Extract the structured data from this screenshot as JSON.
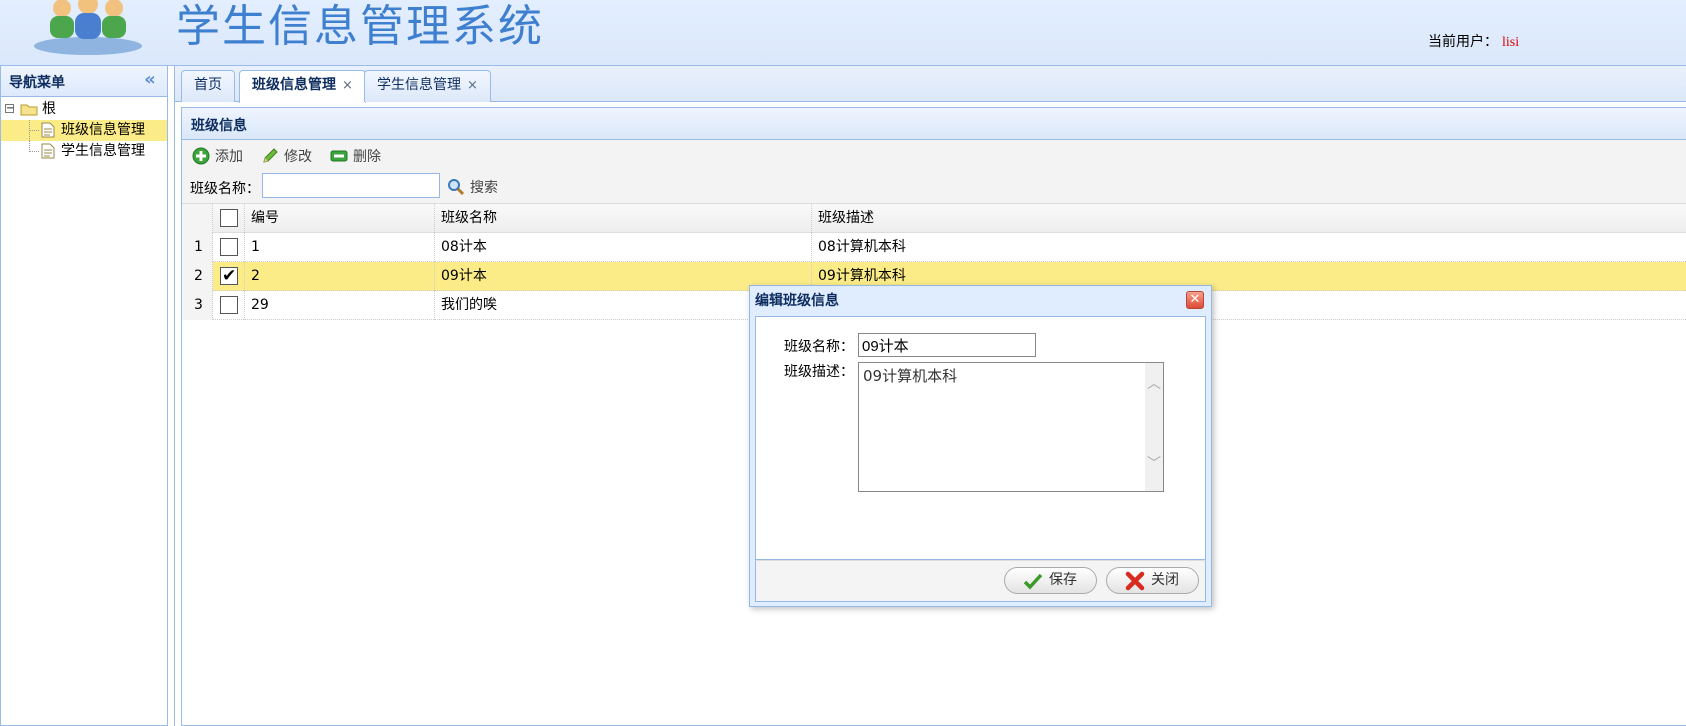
{
  "header": {
    "title": "学生信息管理系统",
    "current_user_label": "当前用户：",
    "current_user": "lisi"
  },
  "nav": {
    "title": "导航菜单",
    "root_label": "根",
    "items": [
      {
        "label": "班级信息管理",
        "selected": true
      },
      {
        "label": "学生信息管理",
        "selected": false
      }
    ]
  },
  "tabs": [
    {
      "label": "首页",
      "closable": false,
      "active": false
    },
    {
      "label": "班级信息管理",
      "closable": true,
      "active": true
    },
    {
      "label": "学生信息管理",
      "closable": true,
      "active": false
    }
  ],
  "panel": {
    "title": "班级信息",
    "toolbar": {
      "add_label": "添加",
      "edit_label": "修改",
      "delete_label": "删除",
      "search_label": "班级名称：",
      "search_value": "",
      "search_button": "搜索"
    }
  },
  "grid": {
    "columns": [
      "编号",
      "班级名称",
      "班级描述"
    ],
    "rows": [
      {
        "num": "1",
        "checked": false,
        "id": "1",
        "name": "08计本",
        "desc": "08计算机本科"
      },
      {
        "num": "2",
        "checked": true,
        "id": "2",
        "name": "09计本",
        "desc": "09计算机本科"
      },
      {
        "num": "3",
        "checked": false,
        "id": "29",
        "name": "我们的唉",
        "desc": ""
      }
    ]
  },
  "dialog": {
    "title": "编辑班级信息",
    "name_label": "班级名称：",
    "name_value": "09计本",
    "desc_label": "班级描述：",
    "desc_value": "09计算机本科",
    "save_label": "保存",
    "close_label": "关闭"
  },
  "colors": {
    "accent": "#99bbe8",
    "selected_row": "#fbec88",
    "title_blue": "#3f7fcf",
    "user_red": "#e00000"
  }
}
